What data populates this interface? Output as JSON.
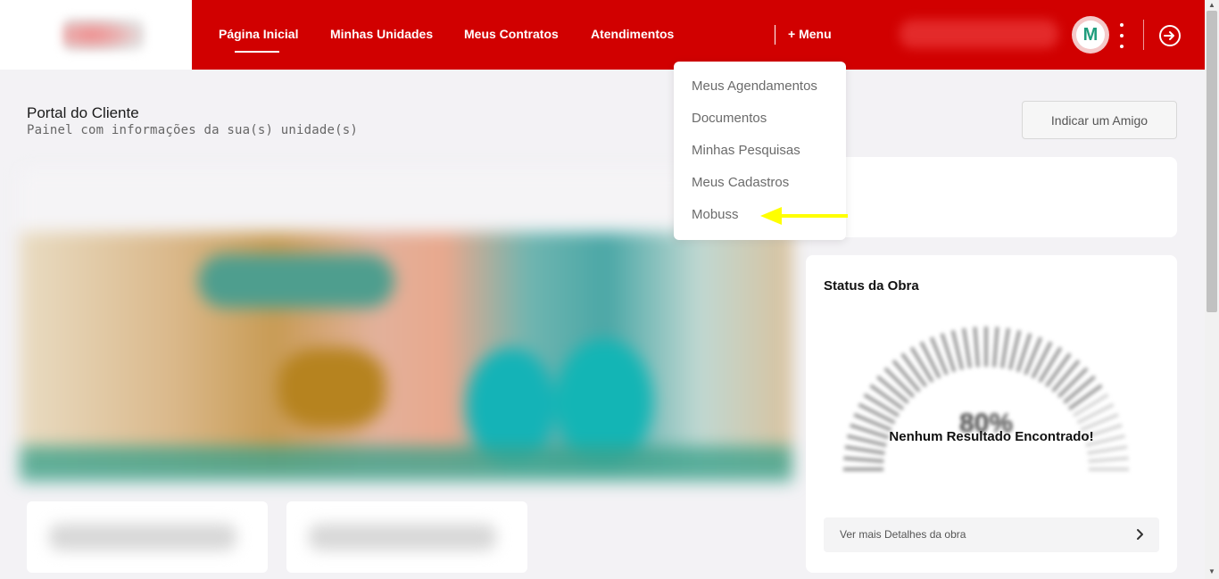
{
  "header": {
    "nav": [
      {
        "label": "Página Inicial",
        "active": true
      },
      {
        "label": "Minhas Unidades",
        "active": false
      },
      {
        "label": "Meus Contratos",
        "active": false
      },
      {
        "label": "Atendimentos",
        "active": false
      }
    ],
    "more_menu_label": "+ Menu",
    "avatar_initial": "M",
    "colors": {
      "brand_red": "#d10000",
      "avatar_green": "#1f9d7d"
    },
    "icons": [
      "kebab-menu-icon",
      "logout-icon"
    ]
  },
  "page": {
    "title": "Portal do Cliente",
    "subtitle": "Painel com informações da sua(s) unidade(s)",
    "indicate_button": "Indicar um Amigo"
  },
  "dropdown": {
    "items": [
      "Meus Agendamentos",
      "Documentos",
      "Minhas Pesquisas",
      "Meus Cadastros",
      "Mobuss"
    ]
  },
  "status_obra": {
    "title": "Status da Obra",
    "gauge_value_text": "80%",
    "gauge_progress": 0.8,
    "no_result": "Nenhum Resultado Encontrado!",
    "details_link": "Ver mais Detalhes da obra"
  },
  "annotation": {
    "color": "#ffff00",
    "points_to": "Mobuss"
  }
}
